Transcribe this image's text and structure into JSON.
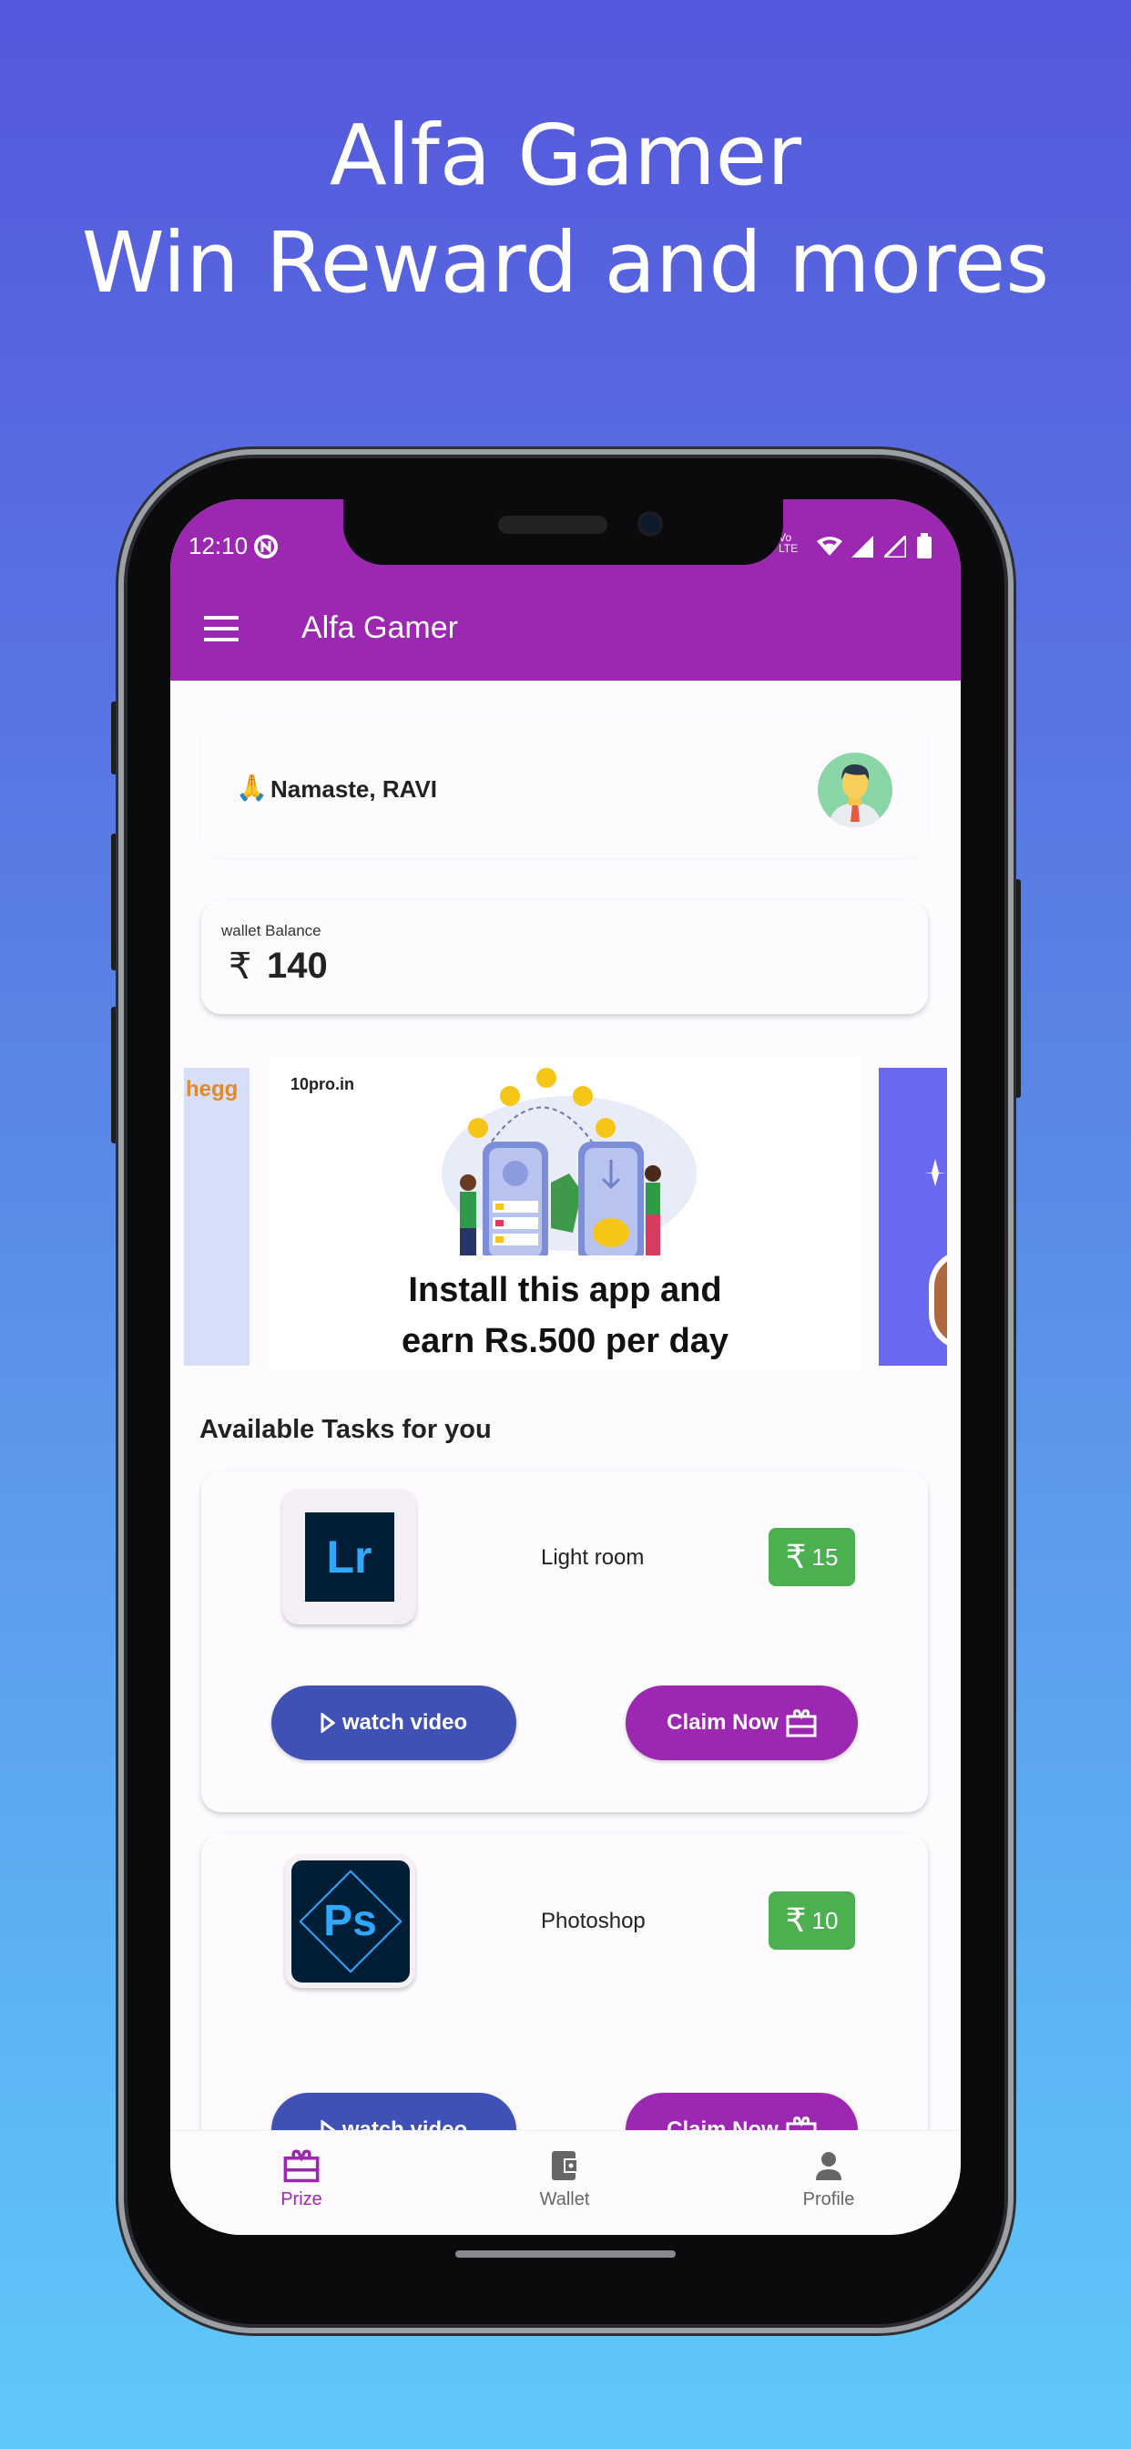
{
  "hero": {
    "line1": "Alfa Gamer",
    "line2": "Win  Reward and mores"
  },
  "status_bar": {
    "time": "12:10",
    "network": "Vo LTE"
  },
  "app_bar": {
    "title": "Alfa Gamer",
    "menu_icon": "hamburger-icon"
  },
  "greeting": {
    "emoji": "🙏",
    "text": "Namaste, RAVI"
  },
  "wallet": {
    "label": "wallet Balance",
    "currency": "₹",
    "amount": "140"
  },
  "banners": {
    "left_partial": {
      "brand": "hegg"
    },
    "center": {
      "brand": "10pro.in",
      "line1": "Install this app and",
      "line2": "earn Rs.500 per day"
    }
  },
  "tasks": {
    "heading": "Available Tasks for you",
    "items": [
      {
        "name": "Light room",
        "logo": "Lr",
        "reward_currency": "₹",
        "reward": "15",
        "watch_label": "watch video",
        "claim_label": "Claim Now"
      },
      {
        "name": "Photoshop",
        "logo": "Ps",
        "reward_currency": "₹",
        "reward": "10",
        "watch_label": "watch video",
        "claim_label": "Claim Now"
      }
    ]
  },
  "bottom_nav": {
    "items": [
      {
        "label": "Prize",
        "icon": "gift-icon",
        "active": true
      },
      {
        "label": "Wallet",
        "icon": "wallet-icon",
        "active": false
      },
      {
        "label": "Profile",
        "icon": "person-icon",
        "active": false
      }
    ]
  },
  "colors": {
    "primary": "#9c27b0",
    "watch_button": "#3f51b5",
    "reward_badge": "#4caf50",
    "background_top": "#5557dc",
    "background_bottom": "#5fc9f9"
  }
}
